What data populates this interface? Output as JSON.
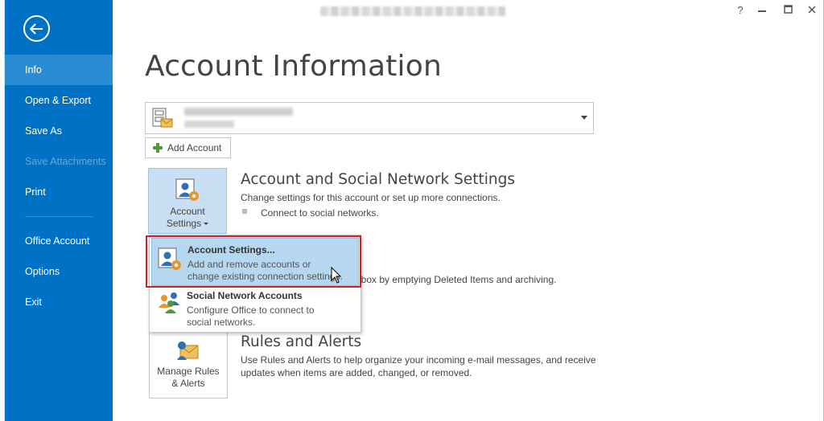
{
  "window": {
    "help": "?",
    "restore": "🗗",
    "maximize": "🗖",
    "close": "✕"
  },
  "sidebar": {
    "items": [
      {
        "label": "Info",
        "state": "active"
      },
      {
        "label": "Open & Export",
        "state": "normal"
      },
      {
        "label": "Save As",
        "state": "normal"
      },
      {
        "label": "Save Attachments",
        "state": "disabled"
      },
      {
        "label": "Print",
        "state": "normal"
      },
      {
        "label": "Office Account",
        "state": "normal"
      },
      {
        "label": "Options",
        "state": "normal"
      },
      {
        "label": "Exit",
        "state": "normal"
      }
    ],
    "color": "#0072c6"
  },
  "page_title": "Account Information",
  "add_account_label": "Add Account",
  "account_settings": {
    "button_line1": "Account",
    "button_line2": "Settings",
    "title": "Account and Social Network Settings",
    "desc": "Change settings for this account or set up more connections.",
    "bullet": "Connect to social networks."
  },
  "cleanup": {
    "desc_partial": "lbox by emptying Deleted Items and archiving."
  },
  "menu": {
    "items": [
      {
        "title": "Account Settings...",
        "desc1": "Add and remove accounts or",
        "desc2": "change existing connection settings."
      },
      {
        "title": "Social Network Accounts",
        "desc1": "Configure Office to connect to",
        "desc2": "social networks."
      }
    ]
  },
  "rules": {
    "button_line1": "Manage Rules",
    "button_line2": "& Alerts",
    "title": "Rules and Alerts",
    "desc1": "Use Rules and Alerts to help organize your incoming e-mail messages, and receive",
    "desc2": "updates when items are added, changed, or removed."
  },
  "colors": {
    "highlight": "#b6d7f0",
    "annotation": "#d61f26"
  }
}
